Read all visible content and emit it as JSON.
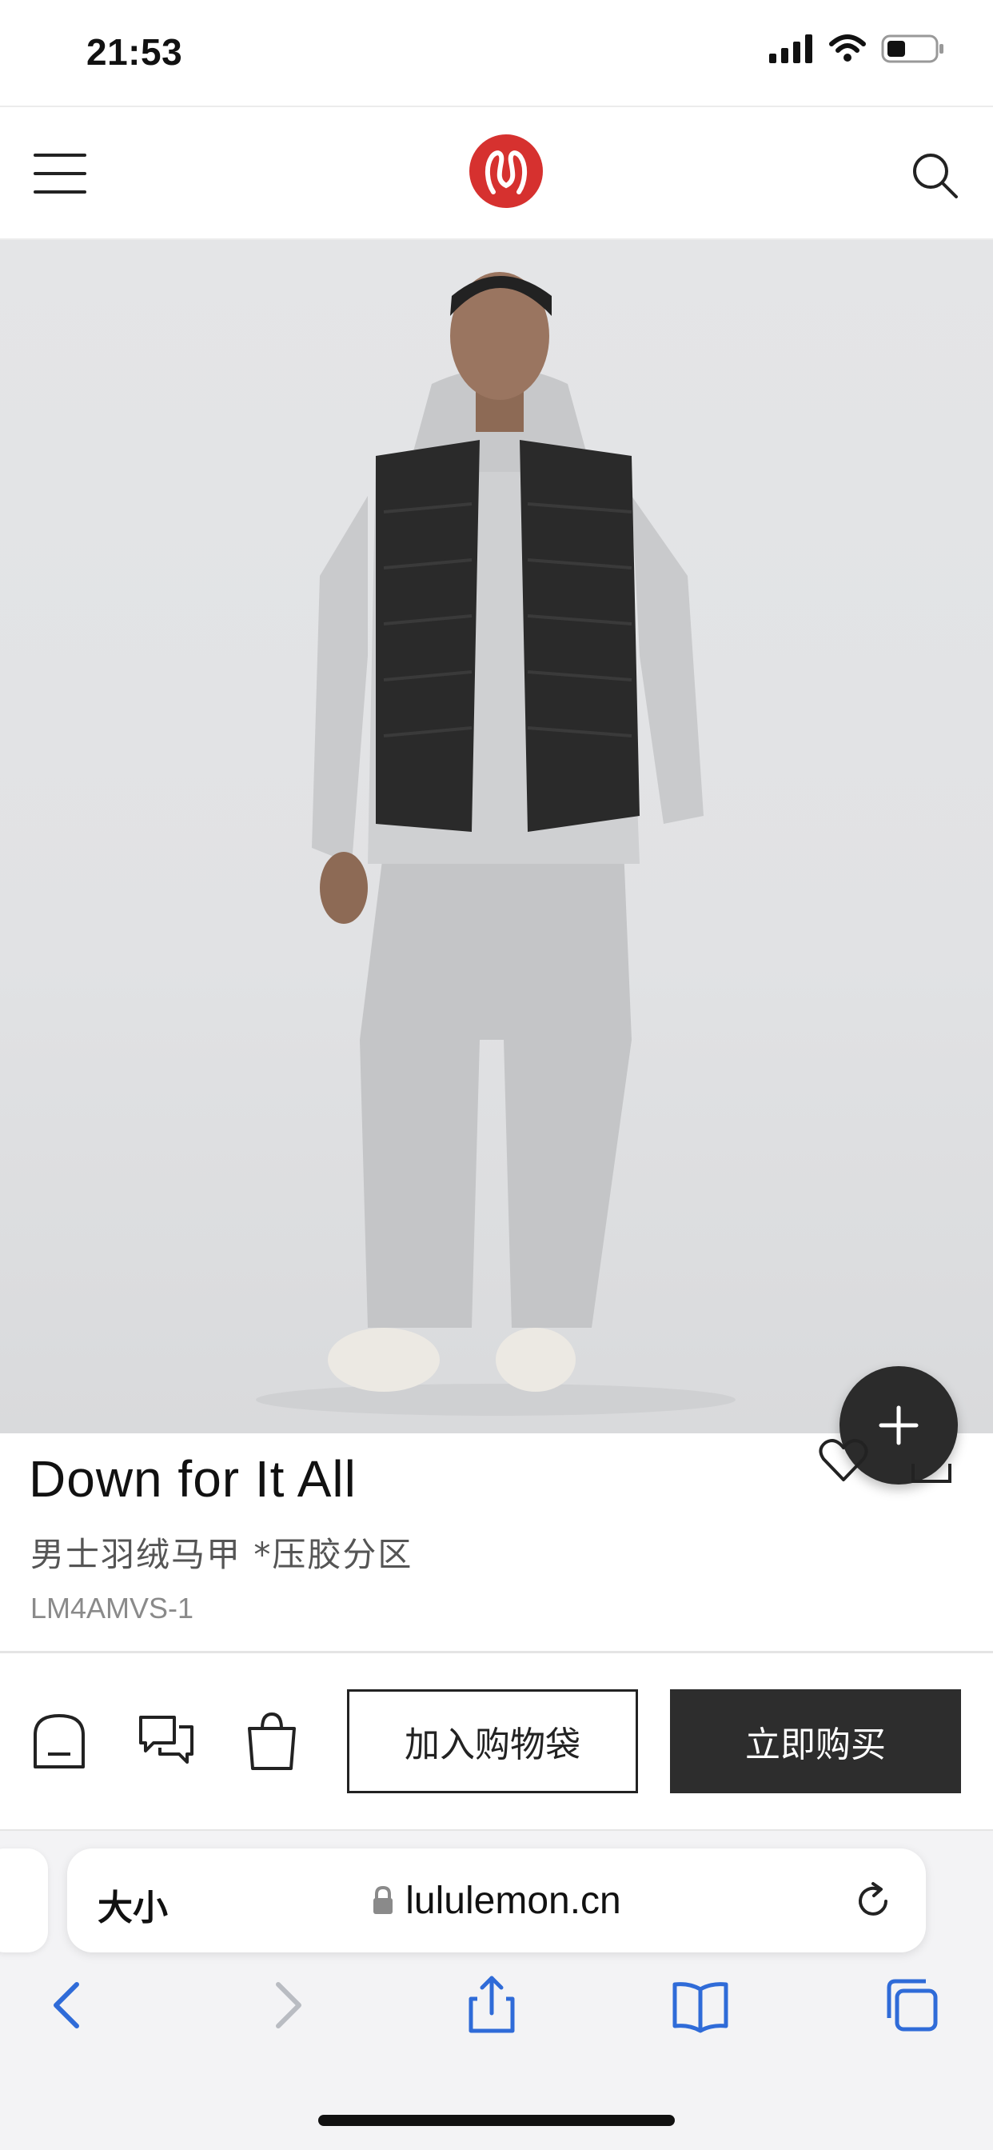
{
  "status_bar": {
    "time": "21:53"
  },
  "header": {
    "logo": "lululemon-logo"
  },
  "product": {
    "name": "Down for It All",
    "subtitle": "男士羽绒马甲 *压胶分区",
    "sku": "LM4AMVS-1"
  },
  "actions": {
    "add_to_bag": "加入购物袋",
    "buy_now": "立即购买"
  },
  "browser": {
    "text_size": "大小",
    "url": "lululemon.cn"
  },
  "colors": {
    "logo_red": "#d6312f",
    "dark_button": "#2d2d2d",
    "link_blue": "#2f6bd8"
  },
  "icons": [
    "menu-icon",
    "search-icon",
    "plus-icon",
    "heart-icon",
    "share-icon",
    "store-icon",
    "chat-icon",
    "bag-icon",
    "lock-icon",
    "reload-icon",
    "back-icon",
    "forward-icon",
    "share-sheet-icon",
    "bookmarks-icon",
    "tabs-icon"
  ]
}
